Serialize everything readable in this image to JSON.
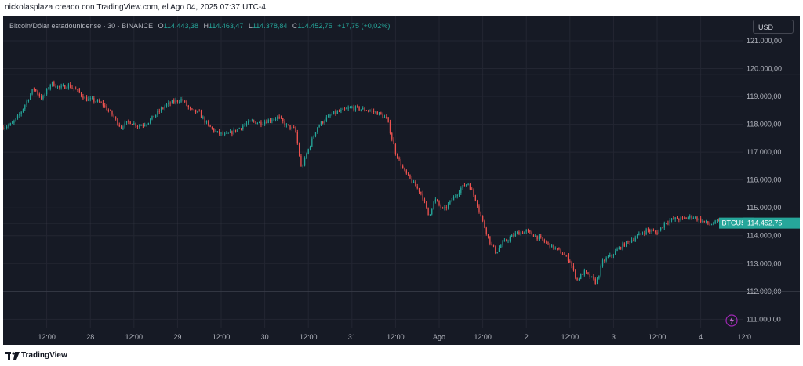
{
  "header": {
    "caption": "nickolasplaza creado con TradingView.com, el Ago 04, 2025 07:37 UTC-4"
  },
  "legend": {
    "symbol_desc": "Bitcoin/Dólar estadounidense · 30 · BINANCE",
    "o_label": "O",
    "o_value": "114.443,38",
    "h_label": "H",
    "h_value": "114.463,47",
    "l_label": "L",
    "l_value": "114.378,84",
    "c_label": "C",
    "c_value": "114.452,75",
    "change": "+17,75 (+0,02%)"
  },
  "currency_button": "USD",
  "footer": {
    "brand": "TradingView"
  },
  "colors": {
    "background": "#161a25",
    "up": "#26a69a",
    "down": "#ef5350",
    "grid": "#232632",
    "axis_text": "#b2b5be",
    "price_tag": "#26a69a"
  },
  "icons": {
    "lightning": "lightning-icon",
    "logo": "tradingview-logo-icon"
  },
  "chart_data": {
    "type": "candlestick",
    "symbol": "BTCUSD",
    "interval": "30",
    "exchange": "BINANCE",
    "last_price_label": "114.452,75",
    "ylim": [
      110700,
      121900
    ],
    "y_ticks": [
      {
        "value": 111000,
        "label": "111.000,00"
      },
      {
        "value": 112000,
        "label": "112.000,00"
      },
      {
        "value": 113000,
        "label": "113.000,00"
      },
      {
        "value": 114000,
        "label": "114.000,00"
      },
      {
        "value": 115000,
        "label": "115.000,00"
      },
      {
        "value": 116000,
        "label": "116.000,00"
      },
      {
        "value": 117000,
        "label": "117.000,00"
      },
      {
        "value": 118000,
        "label": "118.000,00"
      },
      {
        "value": 119000,
        "label": "119.000,00"
      },
      {
        "value": 120000,
        "label": "120.000,00"
      },
      {
        "value": 121000,
        "label": "121.000,00"
      }
    ],
    "x_ticks": [
      {
        "t": 0.5,
        "label": "12:00"
      },
      {
        "t": 1.0,
        "label": "28"
      },
      {
        "t": 1.5,
        "label": "12:00"
      },
      {
        "t": 2.0,
        "label": "29"
      },
      {
        "t": 2.5,
        "label": "12:00"
      },
      {
        "t": 3.0,
        "label": "30"
      },
      {
        "t": 3.5,
        "label": "12:00"
      },
      {
        "t": 4.0,
        "label": "31"
      },
      {
        "t": 4.5,
        "label": "12:00"
      },
      {
        "t": 5.0,
        "label": "Ago"
      },
      {
        "t": 5.5,
        "label": "12:00"
      },
      {
        "t": 6.0,
        "label": "2"
      },
      {
        "t": 6.5,
        "label": "12:00"
      },
      {
        "t": 7.0,
        "label": "3"
      },
      {
        "t": 7.5,
        "label": "12:00"
      },
      {
        "t": 8.0,
        "label": "4"
      },
      {
        "t": 8.5,
        "label": "12:0"
      }
    ],
    "reference_lines": [
      119800,
      114450,
      112000
    ],
    "close_path": [
      [
        0.0,
        117900
      ],
      [
        0.1,
        118000
      ],
      [
        0.18,
        118300
      ],
      [
        0.25,
        118700
      ],
      [
        0.35,
        119300
      ],
      [
        0.45,
        118900
      ],
      [
        0.55,
        119500
      ],
      [
        0.65,
        119300
      ],
      [
        0.75,
        119400
      ],
      [
        0.85,
        119200
      ],
      [
        0.95,
        118900
      ],
      [
        1.05,
        118850
      ],
      [
        1.15,
        118700
      ],
      [
        1.25,
        118350
      ],
      [
        1.35,
        117900
      ],
      [
        1.45,
        118100
      ],
      [
        1.55,
        117950
      ],
      [
        1.65,
        118050
      ],
      [
        1.75,
        118350
      ],
      [
        1.85,
        118650
      ],
      [
        1.95,
        118800
      ],
      [
        2.05,
        118900
      ],
      [
        2.15,
        118500
      ],
      [
        2.25,
        118400
      ],
      [
        2.35,
        117950
      ],
      [
        2.45,
        117700
      ],
      [
        2.55,
        117600
      ],
      [
        2.65,
        117750
      ],
      [
        2.75,
        117950
      ],
      [
        2.85,
        118100
      ],
      [
        2.95,
        118050
      ],
      [
        3.05,
        118150
      ],
      [
        3.15,
        118250
      ],
      [
        3.25,
        117950
      ],
      [
        3.35,
        117800
      ],
      [
        3.42,
        116400
      ],
      [
        3.5,
        117100
      ],
      [
        3.6,
        117900
      ],
      [
        3.7,
        118200
      ],
      [
        3.8,
        118400
      ],
      [
        3.9,
        118500
      ],
      [
        4.0,
        118600
      ],
      [
        4.1,
        118550
      ],
      [
        4.2,
        118500
      ],
      [
        4.3,
        118400
      ],
      [
        4.4,
        118200
      ],
      [
        4.5,
        117000
      ],
      [
        4.6,
        116300
      ],
      [
        4.7,
        115900
      ],
      [
        4.8,
        115500
      ],
      [
        4.88,
        114700
      ],
      [
        4.95,
        115300
      ],
      [
        5.05,
        114900
      ],
      [
        5.15,
        115300
      ],
      [
        5.25,
        115700
      ],
      [
        5.33,
        115900
      ],
      [
        5.42,
        115300
      ],
      [
        5.5,
        114500
      ],
      [
        5.58,
        113800
      ],
      [
        5.65,
        113400
      ],
      [
        5.72,
        113700
      ],
      [
        5.8,
        113900
      ],
      [
        5.9,
        114100
      ],
      [
        6.0,
        114150
      ],
      [
        6.1,
        114000
      ],
      [
        6.2,
        113800
      ],
      [
        6.3,
        113600
      ],
      [
        6.4,
        113400
      ],
      [
        6.5,
        113100
      ],
      [
        6.58,
        112400
      ],
      [
        6.66,
        112700
      ],
      [
        6.74,
        112500
      ],
      [
        6.8,
        112300
      ],
      [
        6.88,
        113100
      ],
      [
        6.98,
        113300
      ],
      [
        7.08,
        113600
      ],
      [
        7.18,
        113800
      ],
      [
        7.28,
        114000
      ],
      [
        7.38,
        114200
      ],
      [
        7.5,
        114100
      ],
      [
        7.6,
        114500
      ],
      [
        7.7,
        114600
      ],
      [
        7.8,
        114600
      ],
      [
        7.9,
        114700
      ],
      [
        8.0,
        114550
      ],
      [
        8.1,
        114400
      ],
      [
        8.2,
        114500
      ],
      [
        8.25,
        114450
      ]
    ]
  }
}
